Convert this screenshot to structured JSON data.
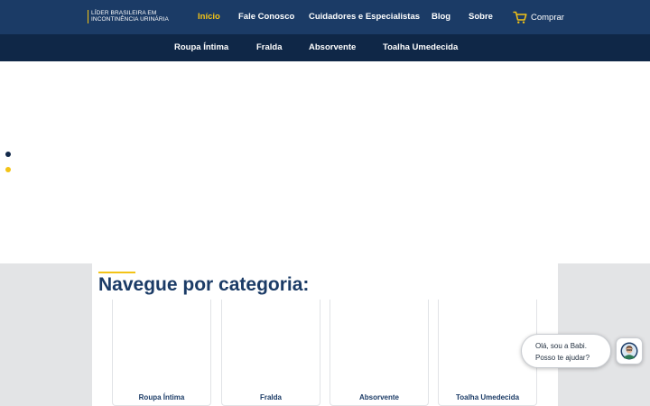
{
  "brand": {
    "line1": "LÍDER BRASILEIRA EM",
    "line2": "INCONTINÊNCIA URINÁRIA"
  },
  "topnav": [
    {
      "label": "Início",
      "active": true
    },
    {
      "label": "Fale Conosco",
      "active": false
    },
    {
      "label": "Cuidadores e Especialistas",
      "active": false
    },
    {
      "label": "Blog",
      "active": false
    },
    {
      "label": "Sobre",
      "active": false
    }
  ],
  "cart": {
    "label": "Comprar",
    "icon": "cart-icon"
  },
  "subnav": [
    "Roupa Íntima",
    "Fralda",
    "Absorvente",
    "Toalha Umedecida"
  ],
  "carousel": {
    "slides": 2,
    "active_slide": 1
  },
  "categories": {
    "title": "Navegue por categoria:",
    "items": [
      "Roupa Íntima",
      "Fralda",
      "Absorvente",
      "Toalha Umedecida"
    ]
  },
  "chat": {
    "line1": "Olá, sou a Babi.",
    "line2": "Posso te ajudar?",
    "icon": "chat-assistant-avatar-icon"
  },
  "colors": {
    "navy": "#1b3b66",
    "navy_dark": "#0f2747",
    "accent_yellow": "#f3c316",
    "section_gray": "#e3e4e6"
  }
}
